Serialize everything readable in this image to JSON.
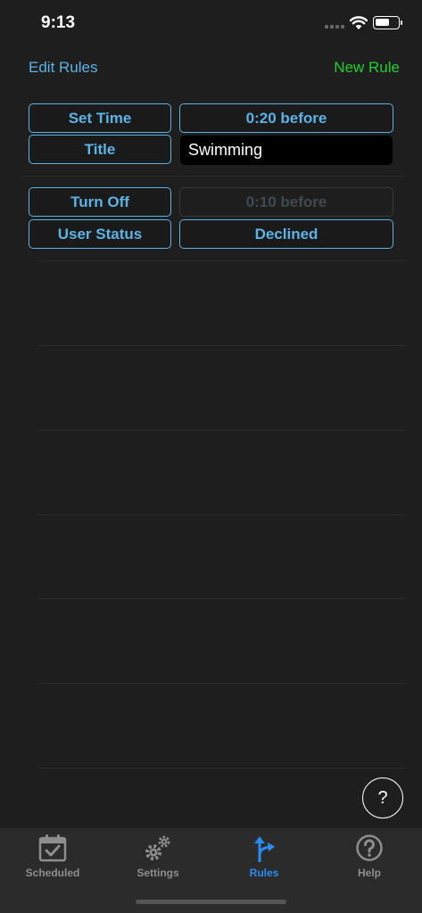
{
  "status_bar": {
    "time": "9:13"
  },
  "nav": {
    "left_label": "Edit Rules",
    "right_label": "New Rule"
  },
  "rules": [
    {
      "rows": [
        {
          "label": "Set Time",
          "value": "0:20 before",
          "value_style": "button"
        },
        {
          "label": "Title",
          "value": "Swimming",
          "value_style": "field"
        }
      ]
    },
    {
      "rows": [
        {
          "label": "Turn Off",
          "value": "0:10 before",
          "value_style": "disabled"
        },
        {
          "label": "User Status",
          "value": "Declined",
          "value_style": "button"
        }
      ]
    }
  ],
  "help_button": {
    "label": "?"
  },
  "tabs": [
    {
      "label": "Scheduled",
      "icon": "calendar-check-icon",
      "active": false
    },
    {
      "label": "Settings",
      "icon": "gears-icon",
      "active": false
    },
    {
      "label": "Rules",
      "icon": "fork-arrow-icon",
      "active": true
    },
    {
      "label": "Help",
      "icon": "question-circle-icon",
      "active": false
    }
  ]
}
